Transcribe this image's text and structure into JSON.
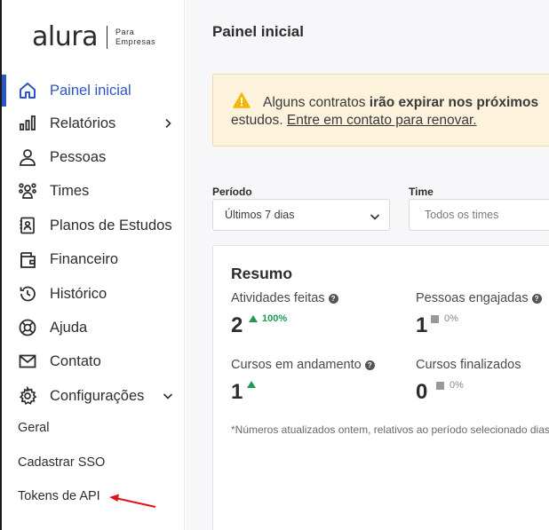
{
  "brand": {
    "name": "alura",
    "sub_line1": "Para",
    "sub_line2": "Empresas"
  },
  "sidebar": {
    "items": [
      {
        "label": "Painel inicial",
        "icon": "home-icon",
        "active": true
      },
      {
        "label": "Relatórios",
        "icon": "bar-chart-icon",
        "chevron": "chevron-right-icon"
      },
      {
        "label": "Pessoas",
        "icon": "person-icon"
      },
      {
        "label": "Times",
        "icon": "team-icon"
      },
      {
        "label": "Planos de Estudos",
        "icon": "study-plan-icon"
      },
      {
        "label": "Financeiro",
        "icon": "wallet-icon"
      },
      {
        "label": "Histórico",
        "icon": "history-icon"
      },
      {
        "label": "Ajuda",
        "icon": "lifebuoy-icon"
      },
      {
        "label": "Contato",
        "icon": "mail-icon"
      },
      {
        "label": "Configurações",
        "icon": "gear-icon",
        "chevron": "chevron-down-icon"
      }
    ],
    "subitems": [
      {
        "label": "Geral"
      },
      {
        "label": "Cadastrar SSO"
      },
      {
        "label": "Tokens de API"
      }
    ]
  },
  "main": {
    "title": "Painel inicial",
    "alert": {
      "text1": "Alguns contratos ",
      "bold": "irão expirar nos próximos",
      "text2": "estudos. ",
      "link": "Entre em contato para renovar."
    },
    "filters": {
      "period": {
        "label": "Período",
        "value": "Últimos 7 dias"
      },
      "team": {
        "label": "Time",
        "placeholder": "Todos os times"
      }
    },
    "summary": {
      "title": "Resumo",
      "metrics": [
        {
          "label": "Atividades feitas",
          "value": "2",
          "delta": "100%",
          "trend": "up"
        },
        {
          "label": "Pessoas engajadas",
          "value": "1",
          "delta": "0%",
          "trend": "flat"
        },
        {
          "label": "Cursos em andamento",
          "value": "1",
          "delta": "",
          "trend": "up"
        },
        {
          "label": "Cursos finalizados",
          "value": "0",
          "delta": "0%",
          "trend": "flat"
        }
      ],
      "note": "*Números atualizados ontem, relativos ao período selecionado dias."
    }
  },
  "colors": {
    "accent": "#2c56c8",
    "positive": "#1e9a55",
    "warning_bg": "#fdf3dd",
    "warning_icon": "#f2b705",
    "annotation": "#e0121a"
  }
}
